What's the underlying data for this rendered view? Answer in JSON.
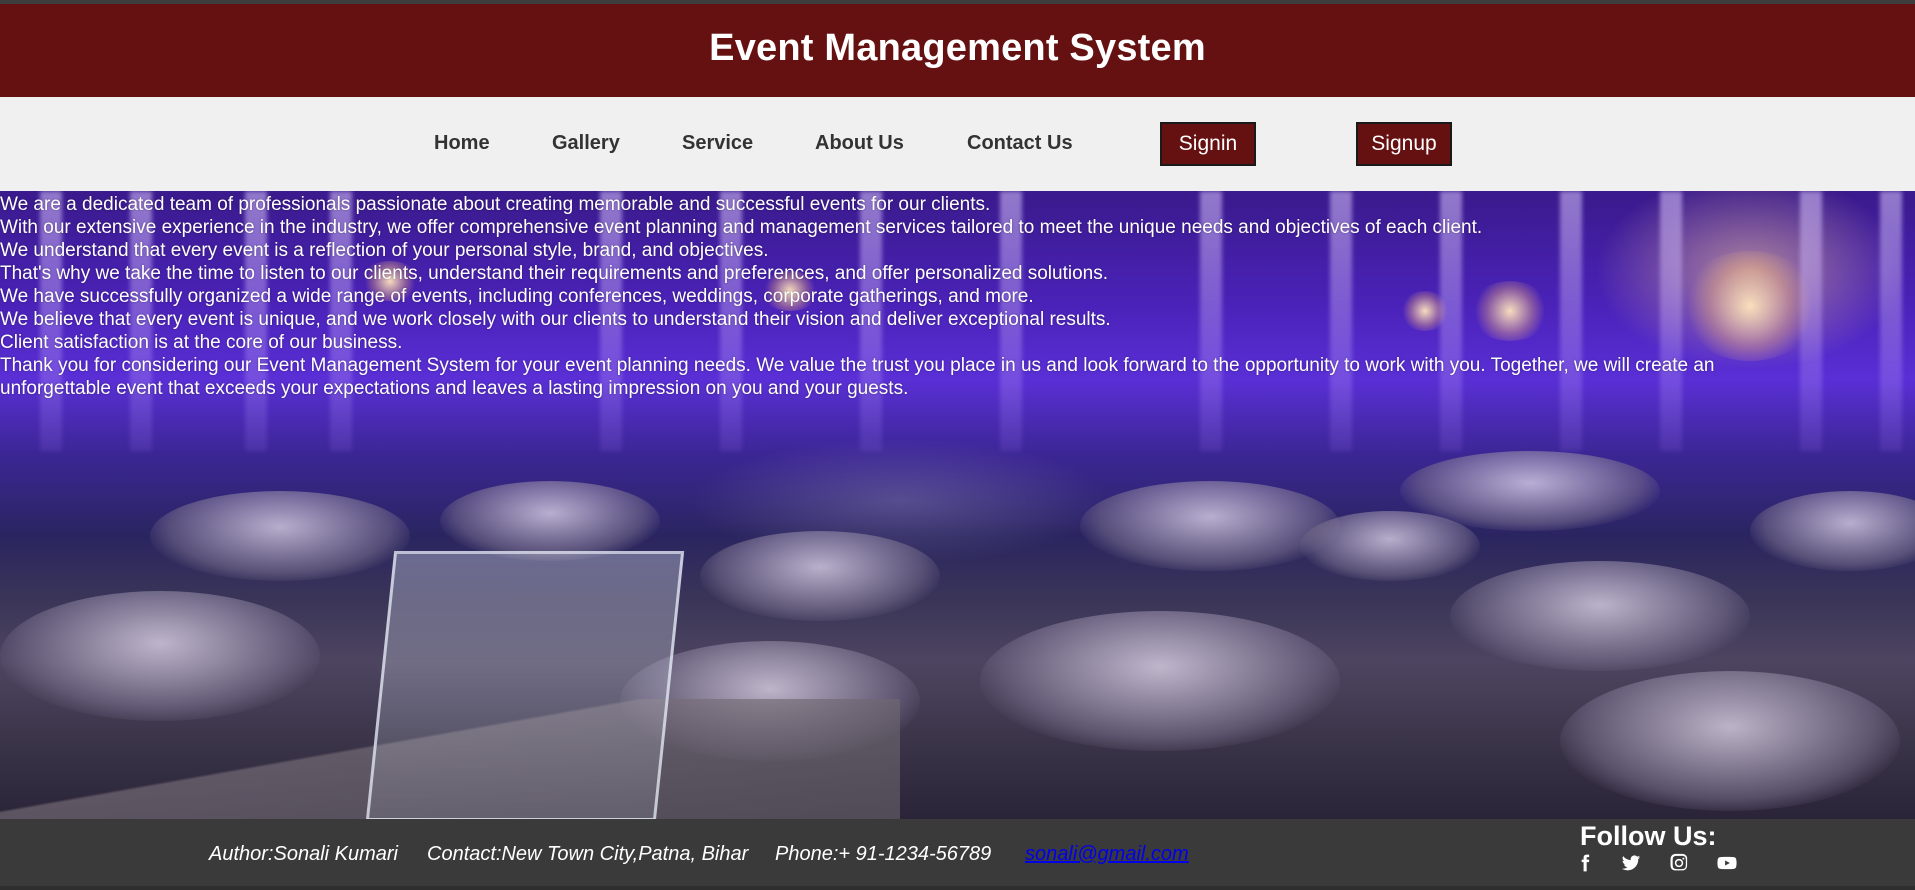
{
  "header": {
    "title": "Event Management System"
  },
  "nav": {
    "links": [
      {
        "label": "Home"
      },
      {
        "label": "Gallery"
      },
      {
        "label": "Service"
      },
      {
        "label": "About Us"
      },
      {
        "label": "Contact Us"
      }
    ],
    "signin_label": "Signin",
    "signup_label": "Signup"
  },
  "about": {
    "paragraphs": [
      "We are a dedicated team of professionals passionate about creating memorable and successful events for our clients.",
      "With our extensive experience in the industry, we offer comprehensive event planning and management services tailored to meet the unique needs and objectives of each client.",
      "We understand that every event is a reflection of your personal style, brand, and objectives.",
      "That's why we take the time to listen to our clients, understand their requirements and preferences, and offer personalized solutions.",
      "We have successfully organized a wide range of events, including conferences, weddings, corporate gatherings, and more.",
      "We believe that every event is unique, and we work closely with our clients to understand their vision and deliver exceptional results.",
      "Client satisfaction is at the core of our business.",
      "Thank you for considering our Event Management System for your event planning needs. We value the trust you place in us and look forward to the opportunity to work with you. Together, we will create an unforgettable event that exceeds your expectations and leaves a lasting impression on you and your guests."
    ]
  },
  "footer": {
    "author": "Author:Sonali Kumari",
    "contact": "Contact:New Town City,Patna, Bihar",
    "phone": "Phone:+ 91-1234-56789",
    "email": "sonali@gmail.com",
    "follow_title": "Follow Us:",
    "social_icons": [
      "facebook-icon",
      "twitter-icon",
      "instagram-icon",
      "youtube-icon"
    ]
  },
  "colors": {
    "brand": "#661111",
    "nav_bg": "#f0f0f0",
    "footer_bg": "#3a3a3a",
    "link": "#0000ee"
  }
}
